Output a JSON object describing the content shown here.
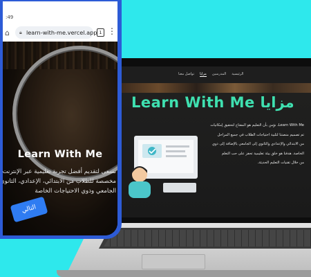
{
  "phone": {
    "status_time": ":49",
    "url": "learn-with-me.vercel.app",
    "tab_count": "1",
    "home_icon": "home-icon",
    "lock_icon": "lock-icon",
    "menu_icon": "more-vert-icon",
    "hero_title": "Learn With Me",
    "hero_lines": [
      "نسعى لتقديم أفضل تجربة تعليمية عبر الإنترنت",
      "مخصصة للطلاب من الابتدائي، الإعدادي، الثانوي",
      "الجامعي وذوي الاحتياجات الخاصة"
    ],
    "next_button": "التالي"
  },
  "laptop": {
    "nav_links": [
      "الرئيسية",
      "المدرسين",
      "مزايا",
      "تواصل معنا"
    ],
    "active_nav": "مزايا",
    "title": "Learn With Me مزايا",
    "para_lines": [
      "Learn With Me، نؤمن بأن التعليم هو المفتاح لتحقيق إمكانيات",
      "تم تصميم منصتنا لتلبية احتياجات الطلاب في جميع المراحل",
      "من الابتدائي والإعدادي والثانوي إلى الجامعي بالإضافة إلى ذوي",
      "الخاصة. هدفنا هو خلق بيئة تعليمية تحفز على حب التعلم",
      "من خلال تقنيات التعليم الحديثة."
    ]
  },
  "colors": {
    "background": "#2ee8ec",
    "phone_frame": "#2d5bd6",
    "button": "#2f7cf2",
    "laptop_title": "#3fe0b0"
  }
}
